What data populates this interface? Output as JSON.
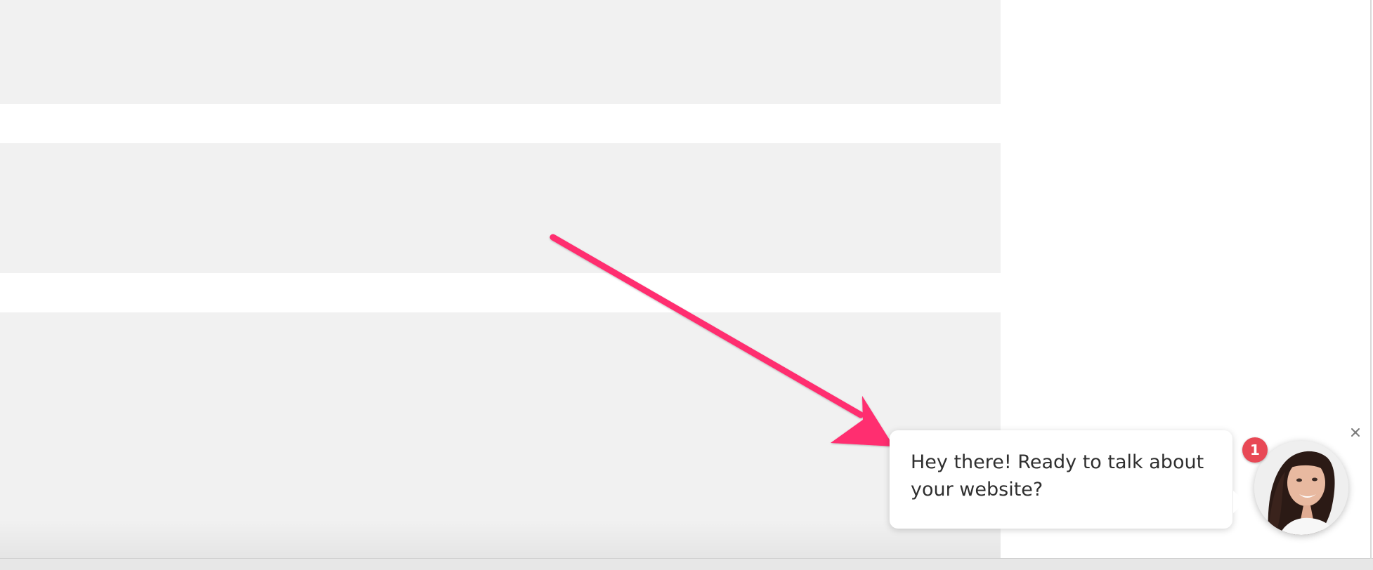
{
  "chat_widget": {
    "message": "Hey there! Ready to talk about your website?",
    "unread_count": "1",
    "icons": {
      "close": "close-icon",
      "avatar": "avatar-photo",
      "arrow": "arrow-icon"
    }
  },
  "colors": {
    "page_background": "#ffffff",
    "placeholder_block": "#f1f1f1",
    "arrow": "#ff2d6f",
    "badge": "#e84855"
  }
}
